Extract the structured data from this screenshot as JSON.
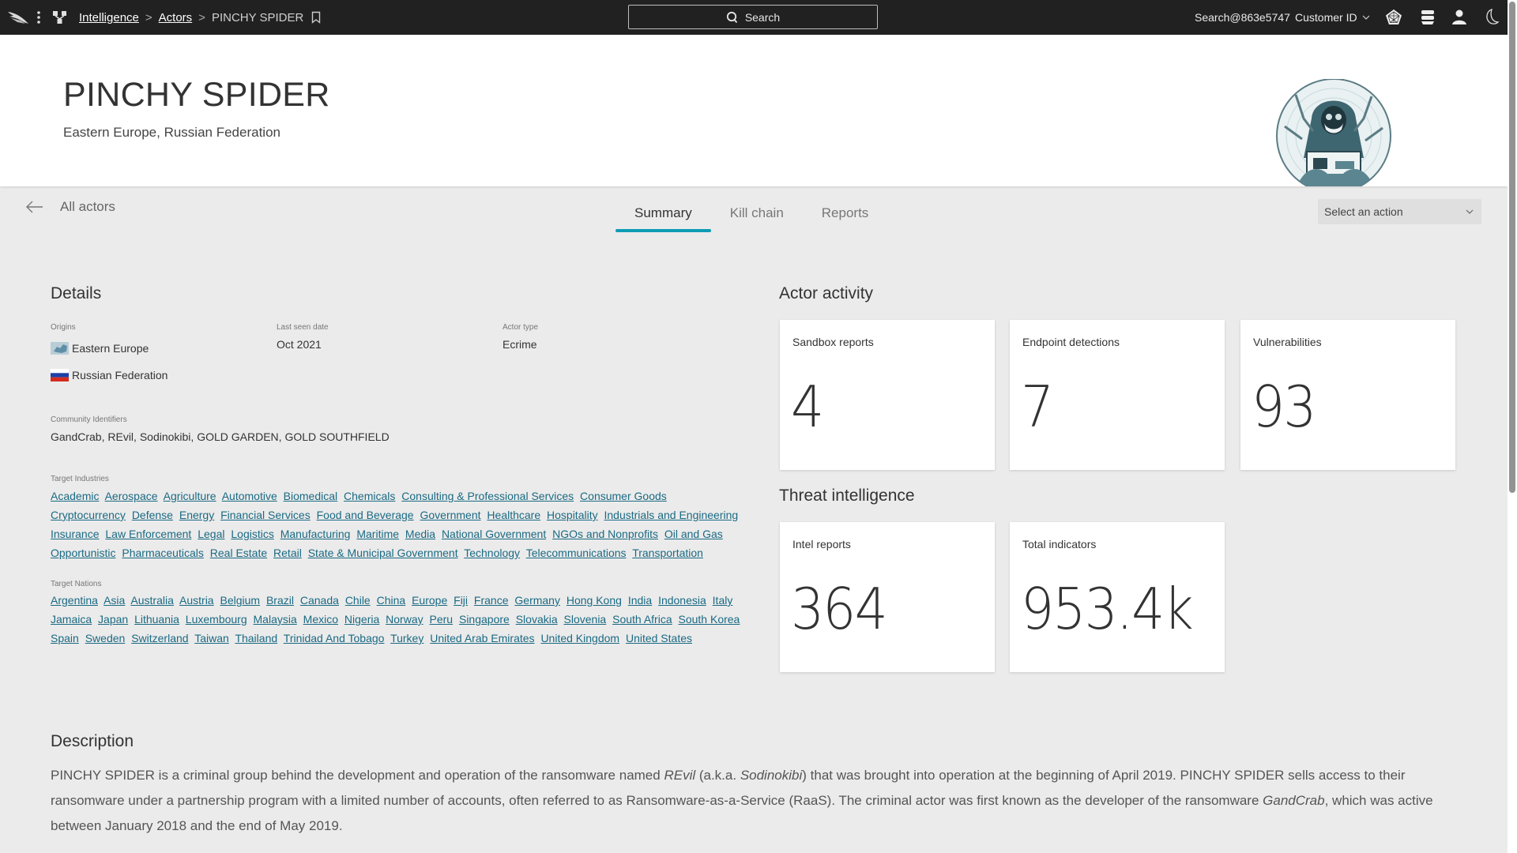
{
  "topbar": {
    "breadcrumb": [
      {
        "label": "Intelligence",
        "link": true
      },
      {
        "label": "Actors",
        "link": true
      },
      {
        "label": "PINCHY SPIDER",
        "link": false
      }
    ],
    "search_label": "Search",
    "user": "Search@863e5747",
    "customer_label": "Customer ID",
    "icons": [
      "falcon-logo-icon",
      "more-vertical-icon",
      "apps-icon",
      "bookmark-icon",
      "search-icon",
      "pentagon-web-icon",
      "notifications-icon",
      "user-icon",
      "dark-mode-icon"
    ]
  },
  "header": {
    "title": "PINCHY SPIDER",
    "subtitle": "Eastern Europe, Russian Federation"
  },
  "nav": {
    "back_label": "All actors",
    "tabs": [
      {
        "label": "Summary",
        "active": true
      },
      {
        "label": "Kill chain",
        "active": false
      },
      {
        "label": "Reports",
        "active": false
      }
    ],
    "action_select": "Select an action"
  },
  "details": {
    "title": "Details",
    "origins_label": "Origins",
    "origins": [
      "Eastern Europe",
      "Russian Federation"
    ],
    "last_seen_label": "Last seen date",
    "last_seen": "Oct 2021",
    "actor_type_label": "Actor type",
    "actor_type": "Ecrime",
    "community_label": "Community Identifiers",
    "community": "GandCrab, REvil, Sodinokibi, GOLD GARDEN, GOLD SOUTHFIELD",
    "industries_label": "Target Industries",
    "industries": [
      "Academic",
      "Aerospace",
      "Agriculture",
      "Automotive",
      "Biomedical",
      "Chemicals",
      "Consulting & Professional Services",
      "Consumer Goods",
      "Cryptocurrency",
      "Defense",
      "Energy",
      "Financial Services",
      "Food and Beverage",
      "Government",
      "Healthcare",
      "Hospitality",
      "Industrials and Engineering",
      "Insurance",
      "Law Enforcement",
      "Legal",
      "Logistics",
      "Manufacturing",
      "Maritime",
      "Media",
      "National Government",
      "NGOs and Nonprofits",
      "Oil and Gas",
      "Opportunistic",
      "Pharmaceuticals",
      "Real Estate",
      "Retail",
      "State & Municipal Government",
      "Technology",
      "Telecommunications",
      "Transportation"
    ],
    "nations_label": "Target Nations",
    "nations": [
      "Argentina",
      "Asia",
      "Australia",
      "Austria",
      "Belgium",
      "Brazil",
      "Canada",
      "Chile",
      "China",
      "Europe",
      "Fiji",
      "France",
      "Germany",
      "Hong Kong",
      "India",
      "Indonesia",
      "Italy",
      "Jamaica",
      "Japan",
      "Lithuania",
      "Luxembourg",
      "Malaysia",
      "Mexico",
      "Nigeria",
      "Norway",
      "Peru",
      "Singapore",
      "Slovakia",
      "Slovenia",
      "South Africa",
      "South Korea",
      "Spain",
      "Sweden",
      "Switzerland",
      "Taiwan",
      "Thailand",
      "Trinidad And Tobago",
      "Turkey",
      "United Arab Emirates",
      "United Kingdom",
      "United States"
    ]
  },
  "activity": {
    "title": "Actor activity",
    "cards": [
      {
        "label": "Sandbox reports",
        "value": "4"
      },
      {
        "label": "Endpoint detections",
        "value": "7"
      },
      {
        "label": "Vulnerabilities",
        "value": "93"
      }
    ]
  },
  "threat": {
    "title": "Threat intelligence",
    "cards": [
      {
        "label": "Intel reports",
        "value": "364"
      },
      {
        "label": "Total indicators",
        "value": "953.4k"
      }
    ]
  },
  "description": {
    "title": "Description",
    "segments": [
      {
        "text": "PINCHY SPIDER is a criminal group behind the development and operation of the ransomware named ",
        "italic": false
      },
      {
        "text": "REvil",
        "italic": true
      },
      {
        "text": " (a.k.a. ",
        "italic": false
      },
      {
        "text": "Sodinokibi",
        "italic": true
      },
      {
        "text": ") that was brought into operation at the beginning of April 2019. PINCHY SPIDER sells access to their ransomware under a partnership program with a limited number of accounts, often referred to as Ransomware-as-a-Service (RaaS). The criminal actor was first known as the developer of the ransomware ",
        "italic": false
      },
      {
        "text": "GandCrab",
        "italic": true
      },
      {
        "text": ", which was active between January 2018 and the end of May 2019.",
        "italic": false
      }
    ]
  },
  "colors": {
    "accent": "#0e9cb4",
    "link": "#1a6a83",
    "topbar_bg": "#212121",
    "page_bg": "#ebebeb"
  }
}
